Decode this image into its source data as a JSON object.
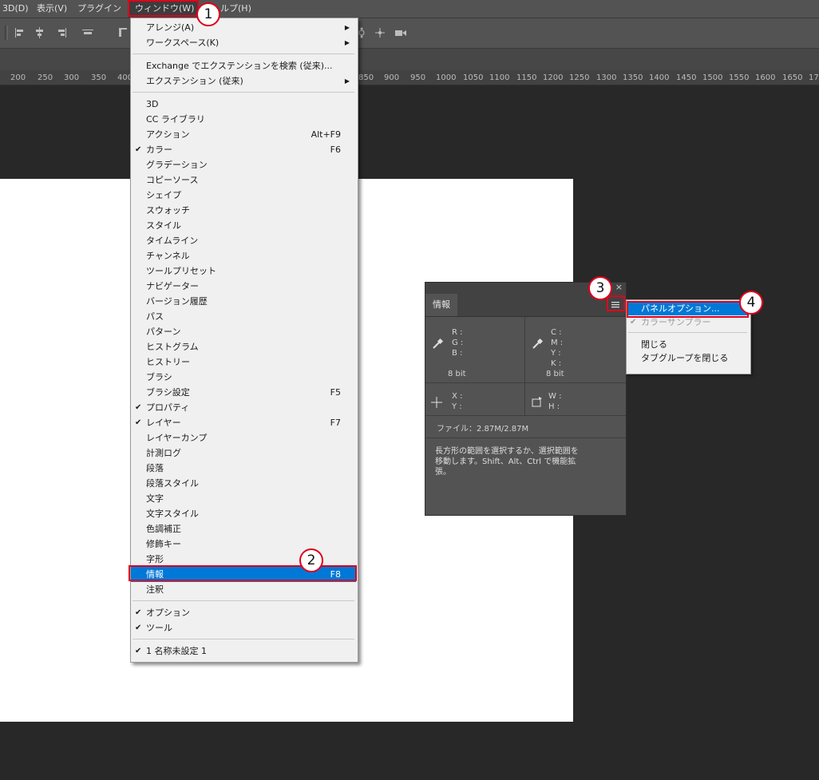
{
  "menubar": {
    "items": [
      "3D(D)",
      "表示(V)",
      "プラグイン",
      "ウィンドウ(W)",
      "ルプ(H)"
    ]
  },
  "ruler": {
    "ticks": [
      "200",
      "250",
      "300",
      "350",
      "400",
      "850",
      "900",
      "950",
      "1000",
      "1050",
      "1100",
      "1150",
      "1200",
      "1250",
      "1300",
      "1350",
      "1400",
      "1450",
      "1500",
      "1550",
      "1600",
      "1650",
      "17"
    ]
  },
  "window_menu": {
    "items": [
      {
        "label": "アレンジ(A)",
        "submenu": true
      },
      {
        "label": "ワークスペース(K)",
        "submenu": true
      },
      {
        "separator": true
      },
      {
        "label": "Exchange でエクステンションを検索 (従来)..."
      },
      {
        "label": "エクステンション (従来)",
        "submenu": true
      },
      {
        "separator": true
      },
      {
        "label": "3D"
      },
      {
        "label": "CC ライブラリ"
      },
      {
        "label": "アクション",
        "shortcut": "Alt+F9"
      },
      {
        "label": "カラー",
        "shortcut": "F6",
        "checked": true
      },
      {
        "label": "グラデーション"
      },
      {
        "label": "コピーソース"
      },
      {
        "label": "シェイプ"
      },
      {
        "label": "スウォッチ"
      },
      {
        "label": "スタイル"
      },
      {
        "label": "タイムライン"
      },
      {
        "label": "チャンネル"
      },
      {
        "label": "ツールプリセット"
      },
      {
        "label": "ナビゲーター"
      },
      {
        "label": "バージョン履歴"
      },
      {
        "label": "パス"
      },
      {
        "label": "パターン"
      },
      {
        "label": "ヒストグラム"
      },
      {
        "label": "ヒストリー"
      },
      {
        "label": "ブラシ"
      },
      {
        "label": "ブラシ設定",
        "shortcut": "F5"
      },
      {
        "label": "プロパティ",
        "checked": true
      },
      {
        "label": "レイヤー",
        "shortcut": "F7",
        "checked": true
      },
      {
        "label": "レイヤーカンプ"
      },
      {
        "label": "計測ログ"
      },
      {
        "label": "段落"
      },
      {
        "label": "段落スタイル"
      },
      {
        "label": "文字"
      },
      {
        "label": "文字スタイル"
      },
      {
        "label": "色調補正"
      },
      {
        "label": "修飾キー"
      },
      {
        "label": "字形"
      },
      {
        "label": "情報",
        "shortcut": "F8",
        "highlighted": true
      },
      {
        "label": "注釈"
      },
      {
        "separator": true
      },
      {
        "label": "オプション",
        "checked": true
      },
      {
        "label": "ツール",
        "checked": true
      },
      {
        "separator": true
      },
      {
        "label": "1 名称未設定 1",
        "checked": true
      }
    ]
  },
  "info_panel": {
    "tab_label": "情報",
    "close_glyph": "×",
    "rgb_labels": [
      "R :",
      "G :",
      "B :"
    ],
    "cmyk_labels": [
      "C :",
      "M :",
      "Y :",
      "K :"
    ],
    "rgb_depth": "8 bit",
    "cmyk_depth": "8 bit",
    "xy_labels": [
      "X :",
      "Y :"
    ],
    "wh_labels": [
      "W :",
      "H :"
    ],
    "file_info": "ファイル：2.87M/2.87M",
    "hint_lines": [
      "長方形の範囲を選択するか、選択範囲を",
      "移動します。Shift、Alt、Ctrl で機能拡",
      "張。"
    ]
  },
  "flyout_menu": {
    "items": [
      {
        "label": "パネルオプション...",
        "highlighted": true
      },
      {
        "label": "カラーサンプラー",
        "checked": true,
        "disabled": true
      },
      {
        "separator": true
      },
      {
        "label": "閉じる"
      },
      {
        "label": "タブグループを閉じる"
      }
    ]
  },
  "annotations": [
    "1",
    "2",
    "3",
    "4"
  ],
  "colors": {
    "highlight": "#0078d7",
    "annotation": "#e0001b",
    "panel": "#535353",
    "background": "#282828"
  }
}
